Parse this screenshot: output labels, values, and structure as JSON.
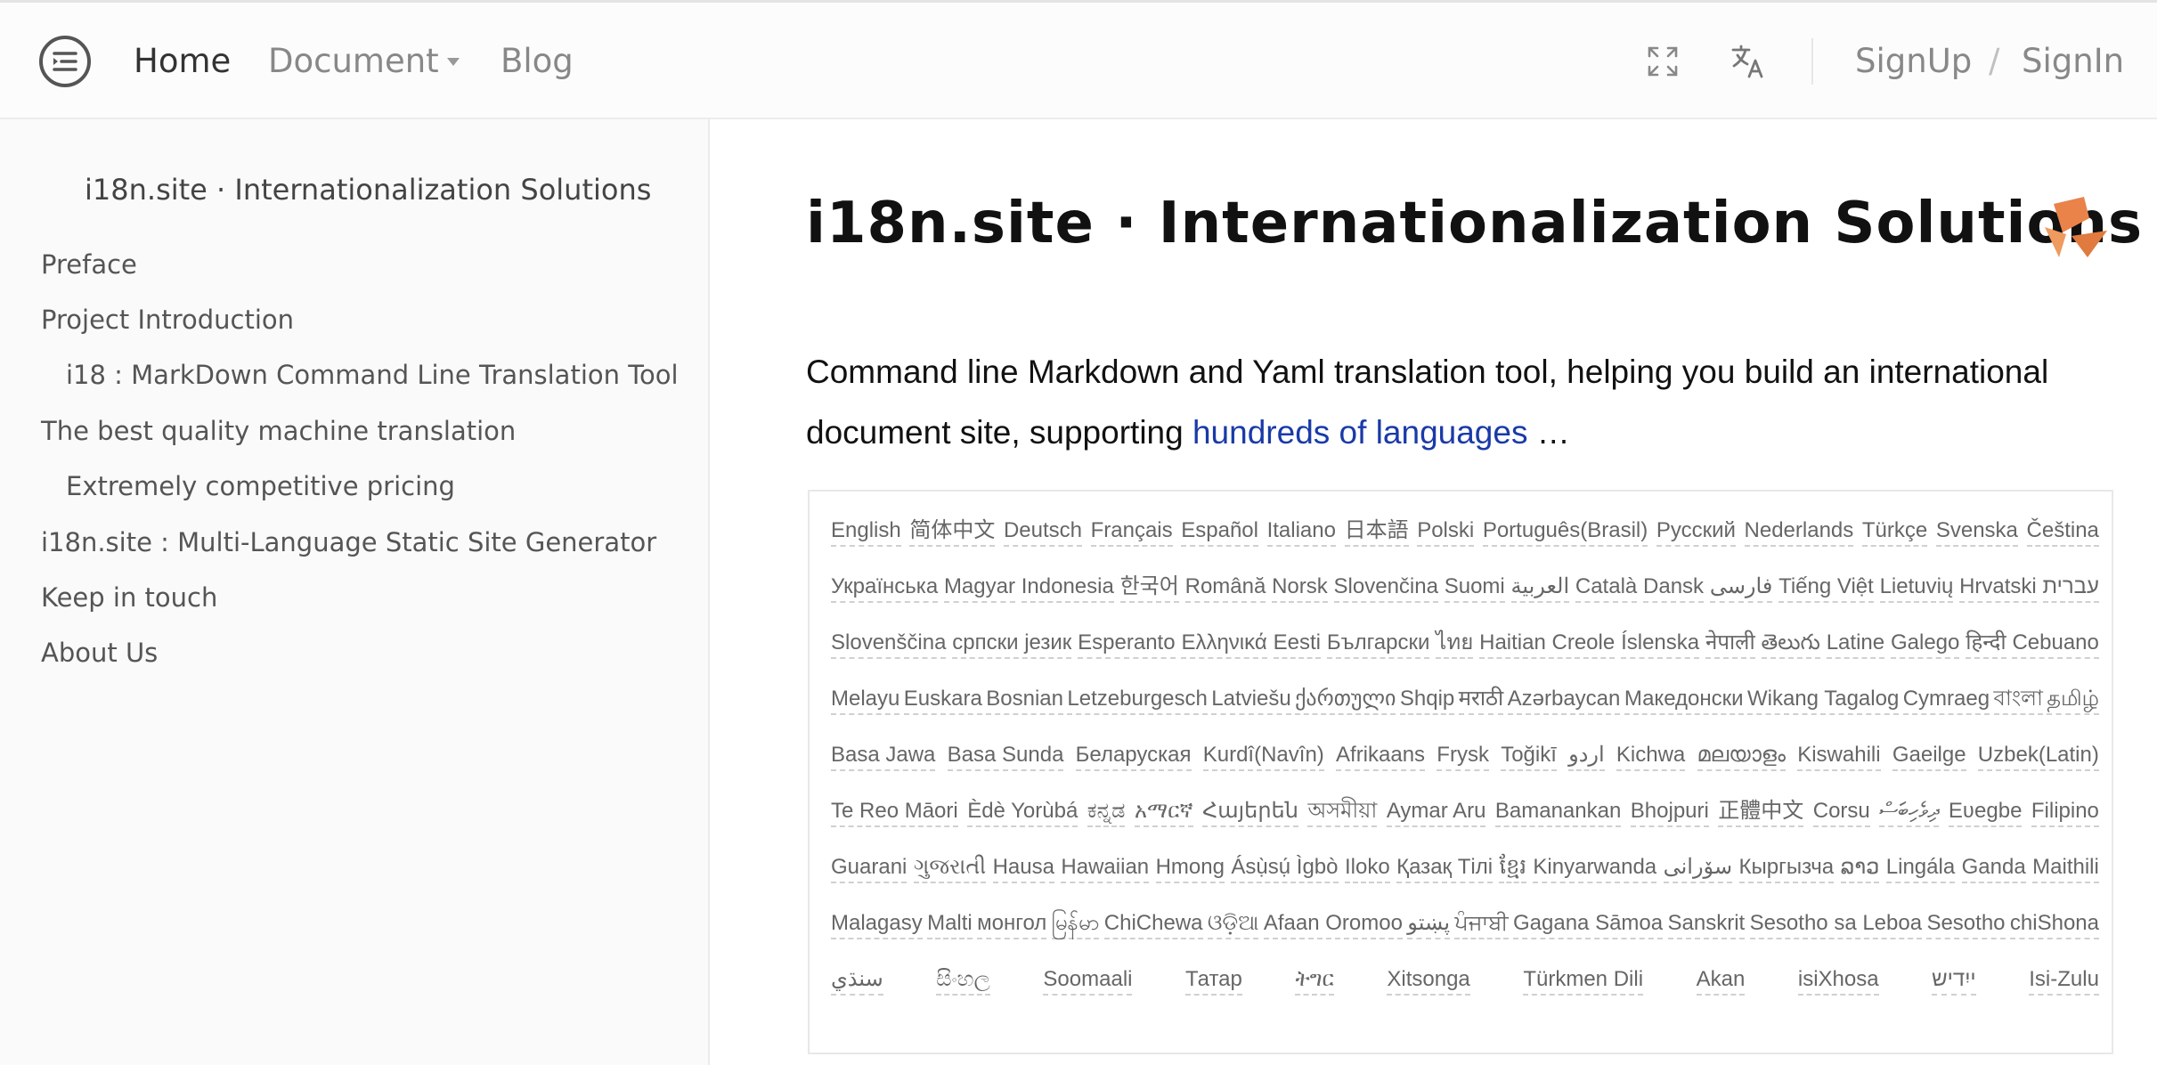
{
  "nav": {
    "home": "Home",
    "document": "Document",
    "blog": "Blog",
    "signup": "SignUp",
    "separator": "/",
    "signin": "SignIn"
  },
  "icons": {
    "menu": "sidebar-toggle-icon",
    "fullscreen": "fullscreen-icon",
    "translate": "translate-icon",
    "caret": "caret-down-icon",
    "logo": "site-logo"
  },
  "colors": {
    "accent_link": "#1a3aa8",
    "logo_orange": "#e9834a"
  },
  "sidebar": {
    "title": "i18n.site · Internationalization Solutions",
    "items": [
      {
        "label": "Preface"
      },
      {
        "label": "Project Introduction"
      },
      {
        "label": "i18 : MarkDown Command Line Translation Tool"
      },
      {
        "label": "The best quality machine translation"
      },
      {
        "label": "Extremely competitive pricing"
      },
      {
        "label": "i18n.site : Multi-Language Static Site Generator"
      },
      {
        "label": "Keep in touch"
      },
      {
        "label": "About Us"
      }
    ]
  },
  "main": {
    "title": "i18n.site · Internationalization Solutions",
    "intro_text": "Command line Markdown and Yaml translation tool, helping you build an international document site, supporting",
    "intro_link": "hundreds of languages",
    "intro_suffix": " …",
    "languages": [
      [
        "English",
        "简体中文",
        "Deutsch",
        "Français",
        "Español",
        "Italiano",
        "日本語",
        "Polski",
        "Português(Brasil)",
        "Русский",
        "Nederlands",
        "Türkçe",
        "Svenska",
        "Čeština"
      ],
      [
        "Українська",
        "Magyar",
        "Indonesia",
        "한국어",
        "Română",
        "Norsk",
        "Slovenčina",
        "Suomi",
        "العربية",
        "Català",
        "Dansk",
        "فارسی",
        "Tiếng Việt",
        "Lietuvių",
        "Hrvatski",
        "עברית"
      ],
      [
        "Slovenščina",
        "српски језик",
        "Esperanto",
        "Ελληνικά",
        "Eesti",
        "Български",
        "ไทย",
        "Haitian Creole",
        "Íslenska",
        "नेपाली",
        "తెలుగు",
        "Latine",
        "Galego",
        "हिन्दी",
        "Cebuano"
      ],
      [
        "Melayu",
        "Euskara",
        "Bosnian",
        "Letzeburgesch",
        "Latviešu",
        "ქართული",
        "Shqip",
        "मराठी",
        "Azərbaycan",
        "Македонски",
        "Wikang Tagalog",
        "Cymraeg",
        "বাংলা",
        "தமிழ்"
      ],
      [
        "Basa Jawa",
        "Basa Sunda",
        "Беларуская",
        "Kurdî(Navîn)",
        "Afrikaans",
        "Frysk",
        "Toğikī",
        "اردو",
        "Kichwa",
        "മലയാളം",
        "Kiswahili",
        "Gaeilge",
        "Uzbek(Latin)"
      ],
      [
        "Te Reo Māori",
        "Èdè Yorùbá",
        "ಕನ್ನಡ",
        "አማርኛ",
        "Հայերեն",
        "অসমীয়া",
        "Aymar Aru",
        "Bamanankan",
        "Bhojpuri",
        "正體中文",
        "Corsu",
        "ދިވެހިބަސް",
        "Eʋegbe",
        "Filipino"
      ],
      [
        "Guarani",
        "ગુજરાતી",
        "Hausa",
        "Hawaiian",
        "Hmong",
        "Ásụ̀sụ́ Ìgbò",
        "Iloko",
        "Қазақ Тілі",
        "ខ្មែរ",
        "Kinyarwanda",
        "سۆرانی",
        "Кыргызча",
        "ລາວ",
        "Lingála",
        "Ganda",
        "Maithili"
      ],
      [
        "Malagasy",
        "Malti",
        "монгол",
        "မြန်မာ",
        "ChiChewa",
        "ଓଡ଼ିଆ",
        "Afaan Oromoo",
        "پښتو",
        "ਪੰਜਾਬੀ",
        "Gagana Sāmoa",
        "Sanskrit",
        "Sesotho sa Leboa",
        "Sesotho",
        "chiShona"
      ],
      [
        "سنڌي",
        "සිංහල",
        "Soomaali",
        "Татар",
        "ትግር",
        "Xitsonga",
        "Türkmen Dili",
        "Akan",
        "isiXhosa",
        "ייִדיש",
        "Isi-Zulu"
      ]
    ]
  }
}
